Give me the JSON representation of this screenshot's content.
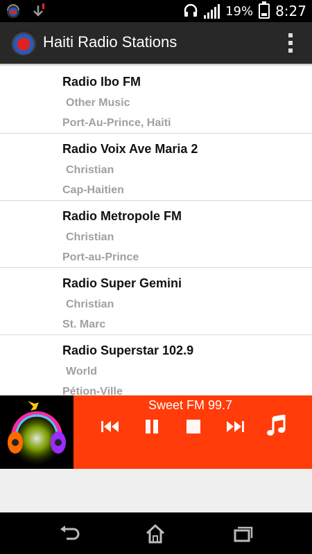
{
  "status_bar": {
    "battery_percent": "19%",
    "time": "8:27"
  },
  "action_bar": {
    "title": "Haiti Radio Stations"
  },
  "stations": [
    {
      "name": "Radio Ibo FM",
      "genre": "Other Music",
      "location": "Port-Au-Prince, Haiti"
    },
    {
      "name": "Radio Voix Ave Maria 2",
      "genre": "Christian",
      "location": "Cap-Haitien"
    },
    {
      "name": "Radio Metropole FM",
      "genre": "Christian",
      "location": "Port-au-Prince"
    },
    {
      "name": "Radio Super Gemini",
      "genre": "Christian",
      "location": "St. Marc"
    },
    {
      "name": "Radio Superstar 102.9",
      "genre": "World",
      "location": "Pétion-Ville"
    }
  ],
  "player": {
    "now_playing": "Sweet FM 99.7",
    "controls": [
      "previous-icon",
      "pause-icon",
      "stop-icon",
      "next-icon",
      "music-note-icon"
    ]
  },
  "navbar": {
    "buttons": [
      "back-icon",
      "home-icon",
      "recent-apps-icon"
    ]
  },
  "colors": {
    "player_bg": "#ff3c0a",
    "action_bar_bg": "#282828",
    "secondary_text": "#a0a0a0"
  }
}
